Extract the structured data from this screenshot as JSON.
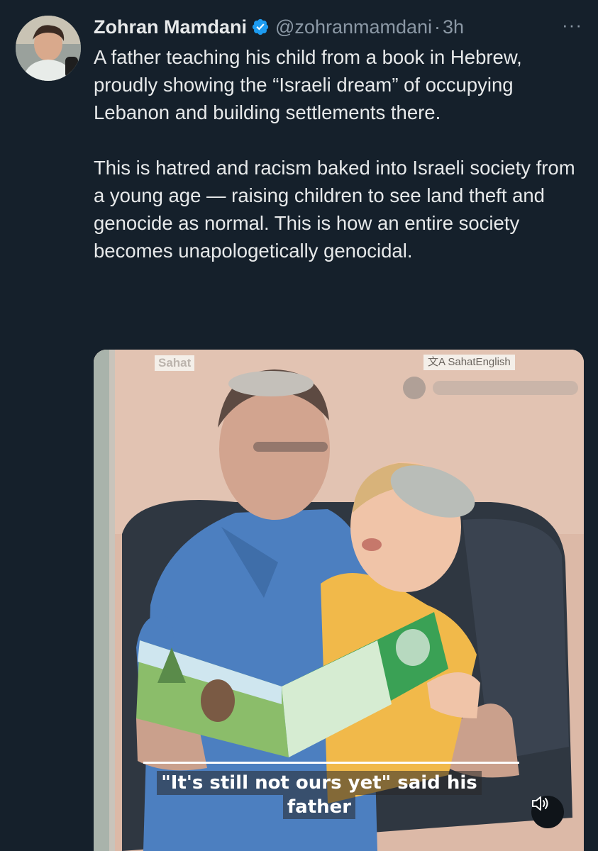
{
  "tweet": {
    "author_name": "Zohran Mamdani",
    "handle": "@zohranmamdani",
    "separator": "·",
    "time": "3h",
    "more_label": "···",
    "paragraphs": [
      "A father teaching his child from a book in Hebrew, proudly showing the “Israeli dream” of occupying Lebanon and building settlements there.",
      "This is hatred and racism baked into Israeli society from a young age — raising children to see land theft and genocide as normal. This is how an entire society becomes unapologetically genocidal."
    ]
  },
  "media": {
    "watermark_left": "Sahat",
    "watermark_right": "SahatEnglish",
    "caption_line1": "\"It's still not ours yet\" said his",
    "caption_line2": "father",
    "mute_icon": "speaker-muted-icon"
  },
  "colors": {
    "background": "#15202b",
    "text": "#e7e9ea",
    "secondary_text": "#8b98a5",
    "verified_badge": "#1d9bf0"
  }
}
